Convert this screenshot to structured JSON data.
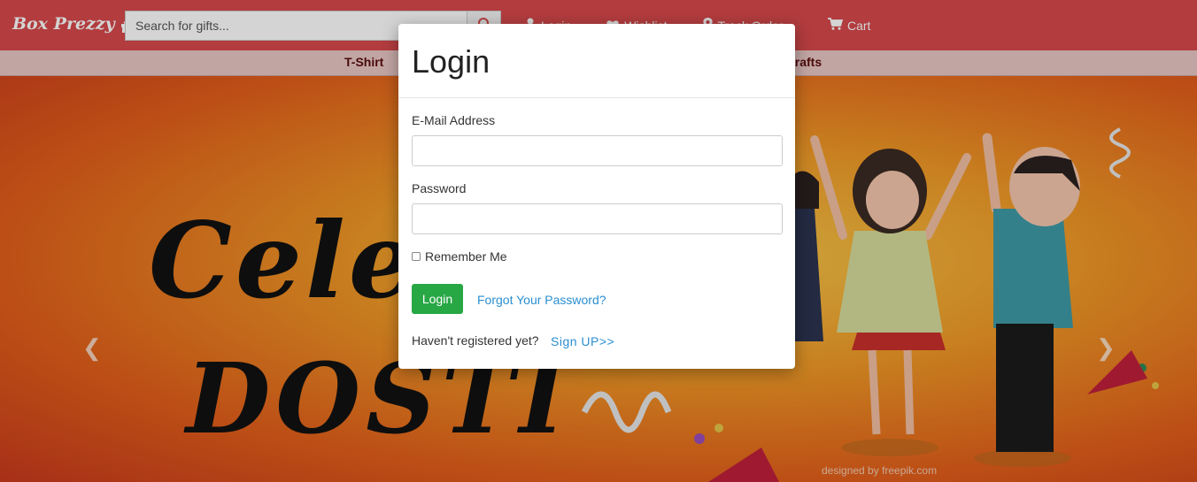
{
  "header": {
    "brand": "Box Prezzy",
    "search_placeholder": "Search for gifts...",
    "nav": [
      {
        "label": "Login",
        "icon": "user-icon"
      },
      {
        "label": "Wishlist",
        "icon": "heart-icon"
      },
      {
        "label": "Track Order",
        "icon": "map-pin-icon"
      }
    ],
    "cart": "Cart"
  },
  "categories": {
    "first": "T-Shirt",
    "last": "crafts"
  },
  "hero": {
    "title": "Celebrate",
    "subtitle": "DOSTI",
    "credit": "designed by freepik.com"
  },
  "modal": {
    "title": "Login",
    "email_label": "E-Mail Address",
    "email_value": "",
    "password_label": "Password",
    "password_value": "",
    "remember_label": "Remember Me",
    "login_button": "Login",
    "forgot_link": "Forgot Your Password?",
    "register_text": "Haven't registered yet?",
    "signup_link": "Sign UP>>"
  },
  "colors": {
    "header_bg": "#d6494b",
    "login_button": "#28a745",
    "link": "#2a8fd0"
  }
}
